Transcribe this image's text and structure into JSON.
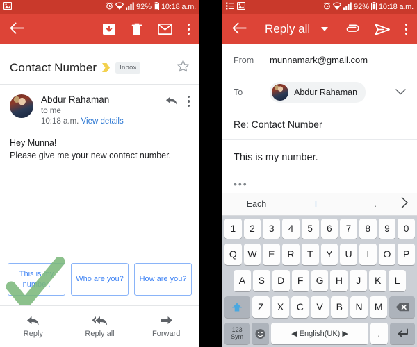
{
  "status_bar": {
    "time": "10:18 a.m.",
    "battery_pct": "92%",
    "icons_left_panel": [
      "image-icon"
    ],
    "icons_right_panel": [
      "list-icon",
      "image-icon"
    ],
    "icons_right": [
      "alarm-icon",
      "wifi-icon",
      "signal-icon",
      "battery-icon"
    ]
  },
  "left_panel": {
    "appbar": {
      "back_icon": "back-arrow-icon",
      "archive_icon": "archive-icon",
      "delete_icon": "trash-icon",
      "mail_icon": "mark-unread-icon",
      "overflow_icon": "more-vertical-icon"
    },
    "subject": "Contact Number",
    "important_marker": "important-chevron-icon",
    "label": "Inbox",
    "star_icon": "star-outline-icon",
    "message": {
      "sender": "Abdur Rahaman",
      "recipient": "to me",
      "time": "10:18 a.m.",
      "details_link": "View details",
      "reply_icon": "reply-arrow-icon",
      "overflow_icon": "more-vertical-icon",
      "body_line1": "Hey Munna!",
      "body_line2": "Please give me your new contact number."
    },
    "smart_replies": [
      "This is my number.",
      "Who are you?",
      "How are you?"
    ],
    "annotation": {
      "type": "green-check-overlay",
      "color": "#7cb87c"
    },
    "bottom_actions": [
      {
        "label": "Reply",
        "icon": "reply-icon"
      },
      {
        "label": "Reply all",
        "icon": "reply-all-icon"
      },
      {
        "label": "Forward",
        "icon": "forward-icon"
      }
    ]
  },
  "right_panel": {
    "appbar": {
      "back_icon": "back-arrow-icon",
      "title": "Reply all",
      "dropdown_icon": "caret-down-icon",
      "attach_icon": "paperclip-icon",
      "send_icon": "send-icon",
      "overflow_icon": "more-vertical-icon"
    },
    "from_label": "From",
    "from_value": "munnamark@gmail.com",
    "to_label": "To",
    "to_value": "Abdur Rahaman",
    "to_expand_icon": "chevron-down-icon",
    "subject_value": "Re: Contact Number",
    "body_value": "This is my number.",
    "quote_toggle": "•••",
    "keyboard": {
      "suggestions": [
        "Each",
        "I",
        "."
      ],
      "next_icon": "chevron-right-icon",
      "row_numbers": [
        "1",
        "2",
        "3",
        "4",
        "5",
        "6",
        "7",
        "8",
        "9",
        "0"
      ],
      "row_q": [
        "Q",
        "W",
        "E",
        "R",
        "T",
        "Y",
        "U",
        "I",
        "O",
        "P"
      ],
      "row_a": [
        "A",
        "S",
        "D",
        "F",
        "G",
        "H",
        "J",
        "K",
        "L"
      ],
      "row_z": [
        "Z",
        "X",
        "C",
        "V",
        "B",
        "N",
        "M"
      ],
      "shift_icon": "shift-up-icon",
      "backspace_icon": "backspace-icon",
      "sym_key_top": "123",
      "sym_key_bottom": "Sym",
      "emoji_icon": "emoji-icon",
      "space_label": "English(UK)",
      "space_left_icon": "triangle-left-icon",
      "space_right_icon": "triangle-right-icon",
      "period_key": ".",
      "enter_icon": "enter-icon"
    }
  },
  "colors": {
    "appbar_red": "#dd4437",
    "statusbar_red": "#c9392b",
    "link_blue": "#2a76d2",
    "chip_blue": "#4285f4",
    "check_green": "#7cb87c"
  }
}
